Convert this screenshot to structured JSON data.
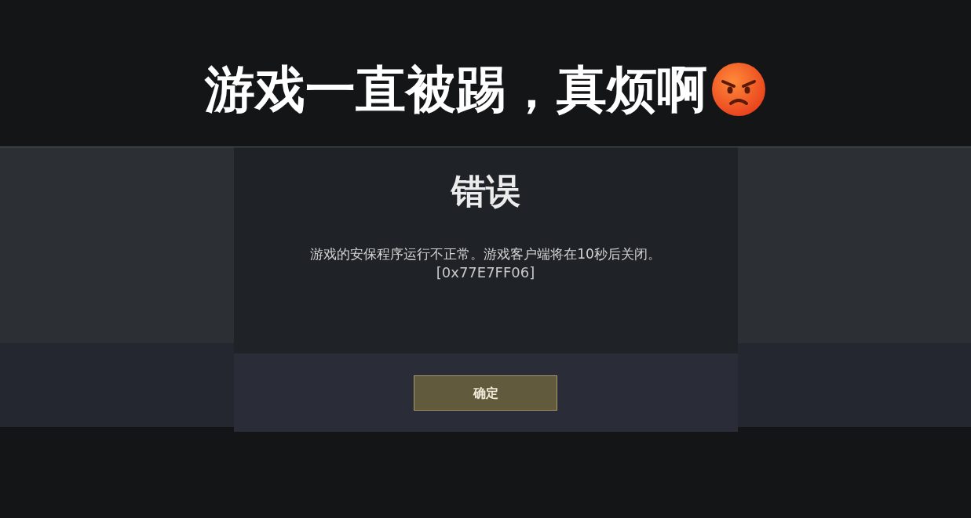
{
  "caption": {
    "text": "游戏一直被踢，真烦啊"
  },
  "dialog": {
    "title": "错误",
    "message": "游戏的安保程序运行不正常。游戏客户端将在10秒后关闭。",
    "code": "[0x77E7FF06]",
    "button": "确定"
  }
}
